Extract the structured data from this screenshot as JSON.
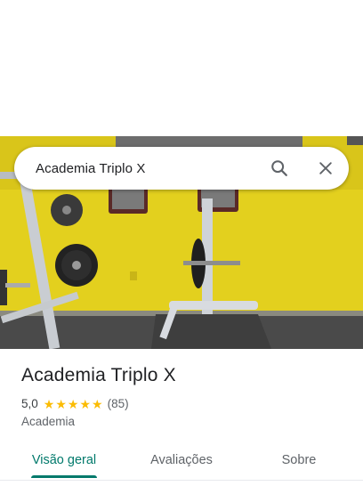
{
  "search": {
    "query": "Academia Triplo X",
    "search_icon": "search-icon",
    "close_icon": "close-icon"
  },
  "photo": {
    "description_icon": "gym-photo",
    "wall_color": "#e5d21c"
  },
  "place": {
    "title": "Academia Triplo X",
    "rating_value": "5,0",
    "star_count": 5,
    "stars": [
      "★",
      "★",
      "★",
      "★",
      "★"
    ],
    "review_count": "(85)",
    "category": "Academia"
  },
  "tabs": [
    {
      "label": "Visão geral",
      "active": true
    },
    {
      "label": "Avaliações",
      "active": false
    },
    {
      "label": "Sobre",
      "active": false
    }
  ],
  "colors": {
    "accent": "#00796b",
    "star": "#fbbc04"
  }
}
